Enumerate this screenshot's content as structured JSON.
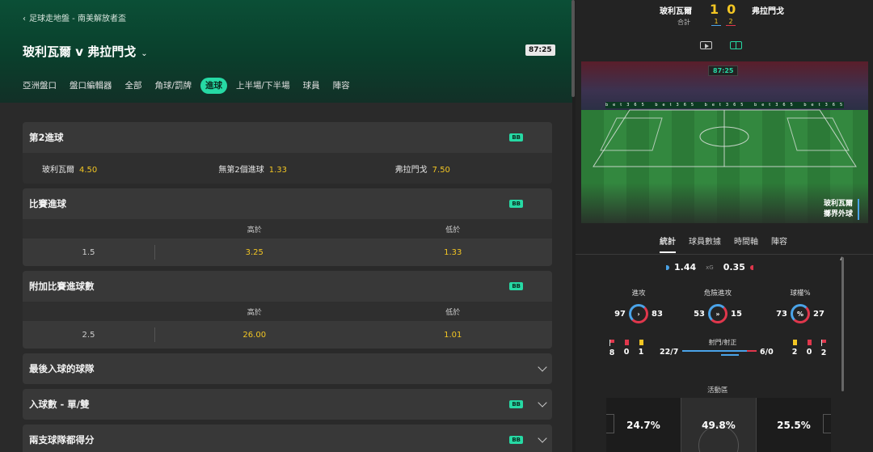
{
  "breadcrumb": {
    "text": "足球走地盤 - 南美解放者盃"
  },
  "match": {
    "title": "玻利瓦爾 v 弗拉門戈",
    "clock": "87:25"
  },
  "tabs": [
    "亞洲盤口",
    "盤口編輯器",
    "全部",
    "角球/罰牌",
    "進球",
    "上半場/下半場",
    "球員",
    "陣容"
  ],
  "active_tab": "進球",
  "markets": {
    "second_goal": {
      "title": "第2進球",
      "badge": "BB",
      "options": [
        {
          "label": "玻利瓦爾",
          "odds": "4.50"
        },
        {
          "label": "無第2個進球",
          "odds": "1.33"
        },
        {
          "label": "弗拉門戈",
          "odds": "7.50"
        }
      ]
    },
    "match_goals": {
      "title": "比賽進球",
      "badge": "BB",
      "over_label": "高於",
      "under_label": "低於",
      "line": "1.5",
      "over": "3.25",
      "under": "1.33"
    },
    "alt_goals": {
      "title": "附加比賽進球數",
      "badge": "BB",
      "over_label": "高於",
      "under_label": "低於",
      "line": "2.5",
      "over": "26.00",
      "under": "1.01"
    },
    "last_team": {
      "title": "最後入球的球隊"
    },
    "odd_even": {
      "title": "入球數 - 單/雙",
      "badge": "BB"
    },
    "btts": {
      "title": "兩支球隊都得分",
      "badge": "BB"
    }
  },
  "scoreboard": {
    "home": "玻利瓦爾",
    "away": "弗拉門戈",
    "home_score": "1",
    "away_score": "0",
    "total_label": "合計",
    "home_total": "1",
    "away_total": "2"
  },
  "stadium": {
    "clock": "87:25",
    "ads": "bet365 bet365 bet365 bet365 bet365 bet365 bet365 bet365 bet365",
    "event_team": "玻利瓦爾",
    "event_text": "擲界外球"
  },
  "stat_tabs": [
    "統計",
    "球員數據",
    "時間軸",
    "陣容"
  ],
  "active_stat_tab": "統計",
  "xg": {
    "home": "1.44",
    "label": "xG",
    "away": "0.35"
  },
  "kpis": [
    {
      "label": "進攻",
      "home": "97",
      "away": "83",
      "icon": "chevron-right-icon"
    },
    {
      "label": "危險進攻",
      "home": "53",
      "away": "15",
      "icon": "double-chevron-icon"
    },
    {
      "label": "球權%",
      "home": "73",
      "away": "27",
      "icon": "percent-icon"
    }
  ],
  "home_cards": {
    "corners": "8",
    "red": "0",
    "yellow": "1"
  },
  "away_cards": {
    "yellow": "2",
    "red": "0",
    "corners": "2"
  },
  "shots": {
    "label": "射門/射正",
    "home": "22/7",
    "away": "6/0"
  },
  "zones": {
    "label": "活動區",
    "left": "24.7%",
    "middle": "49.8%",
    "right": "25.5%"
  },
  "colors": {
    "accent": "#26d9a4",
    "odds": "#f3c623",
    "home": "#4aa3e8",
    "away": "#e0374c"
  }
}
